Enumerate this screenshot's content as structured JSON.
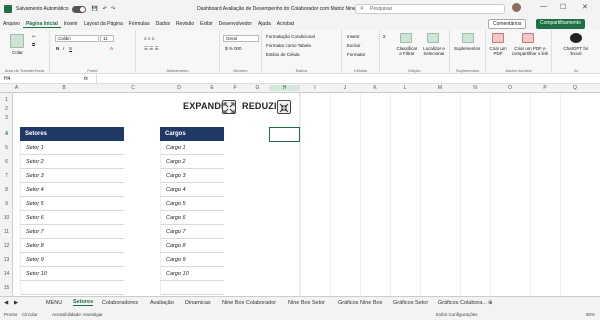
{
  "titlebar": {
    "autosave": "Salvamento Automático",
    "title": "Dashboard Avaliação de Desempenho do Colaborador com Matriz Nine Box.xlsm",
    "search_placeholder": "Pesquisar"
  },
  "menubar": {
    "items": [
      "Arquivo",
      "Página Inicial",
      "Inserir",
      "Layout da Página",
      "Fórmulas",
      "Dados",
      "Revisão",
      "Exibir",
      "Desenvolvedor",
      "Ajuda",
      "Acrobat"
    ],
    "comments": "Comentários",
    "share": "Compartilhamento"
  },
  "ribbon": {
    "clipboard": {
      "paste": "Colar",
      "label": "Área de Transferência"
    },
    "font": {
      "name": "Calibri",
      "size": "11",
      "label": "Fonte"
    },
    "alignment": {
      "label": "Alinhamento"
    },
    "number": {
      "format": "Geral",
      "label": "Número"
    },
    "styles": {
      "cond": "Formatação Condicional",
      "table": "Formatar como Tabela",
      "cell": "Estilos de Célula",
      "label": "Estilos"
    },
    "cells": {
      "insert": "Inserir",
      "delete": "Excluir",
      "format": "Formatar",
      "label": "Células"
    },
    "editing": {
      "sort": "Classificar e Filtrar",
      "find": "Localizar e Selecionar",
      "label": "Edição"
    },
    "addins": {
      "btn": "Suplementos",
      "label": "Suplementos"
    },
    "acrobat": {
      "pdf": "Criar um PDF",
      "share": "Criar um PDF e compartilhar o link",
      "label": "Adobe Acrobat"
    },
    "ai": {
      "btn": "ChatGPT for Excel",
      "label": "AI"
    }
  },
  "formulabar": {
    "namebox": "H4",
    "fx": "fx",
    "value": ""
  },
  "columns": [
    "A",
    "B",
    "C",
    "D",
    "E",
    "F",
    "G",
    "H",
    "I",
    "J",
    "K",
    "L",
    "M",
    "N",
    "O",
    "P",
    "Q"
  ],
  "rows": [
    "1",
    "2",
    "3",
    "4",
    "5",
    "6",
    "7",
    "8",
    "9",
    "10",
    "11",
    "12",
    "13",
    "14",
    "15",
    "16",
    "17",
    "18",
    "19",
    "20",
    "21",
    "22",
    "23",
    "24"
  ],
  "controls": {
    "expand": "EXPANDIR",
    "reduce": "REDUZIR"
  },
  "setores": {
    "header": "Setores",
    "items": [
      "Setor 1",
      "Setor 2",
      "Setor 3",
      "Setor 4",
      "Setor 5",
      "Setor 6",
      "Setor 7",
      "Setor 8",
      "Setor 9",
      "Setor 10",
      "",
      ""
    ]
  },
  "cargos": {
    "header": "Cargos",
    "items": [
      "Cargo 1",
      "Cargo 2",
      "Cargo 3",
      "Cargo 4",
      "Cargo 5",
      "Cargo 6",
      "Cargo 7",
      "Cargo 8",
      "Cargo 9",
      "Cargo 10",
      "",
      ""
    ]
  },
  "tabs": [
    "MENU",
    "Setores",
    "Colaboradores",
    "Avaliação",
    "Dinamicas",
    "Nine Box Colaborador",
    "Nine Box Setor",
    "Gráficos Nine Box",
    "Gráficos Setor",
    "Gráficos Colabora..."
  ],
  "statusbar": {
    "ready": "Pronto",
    "circ": "Circular",
    "access": "Acessibilidade: Investigar",
    "display": "Exibir Configurações",
    "zoom": "90%"
  },
  "colors": {
    "header_bg": "#1f3864",
    "accent": "#1e7145"
  }
}
